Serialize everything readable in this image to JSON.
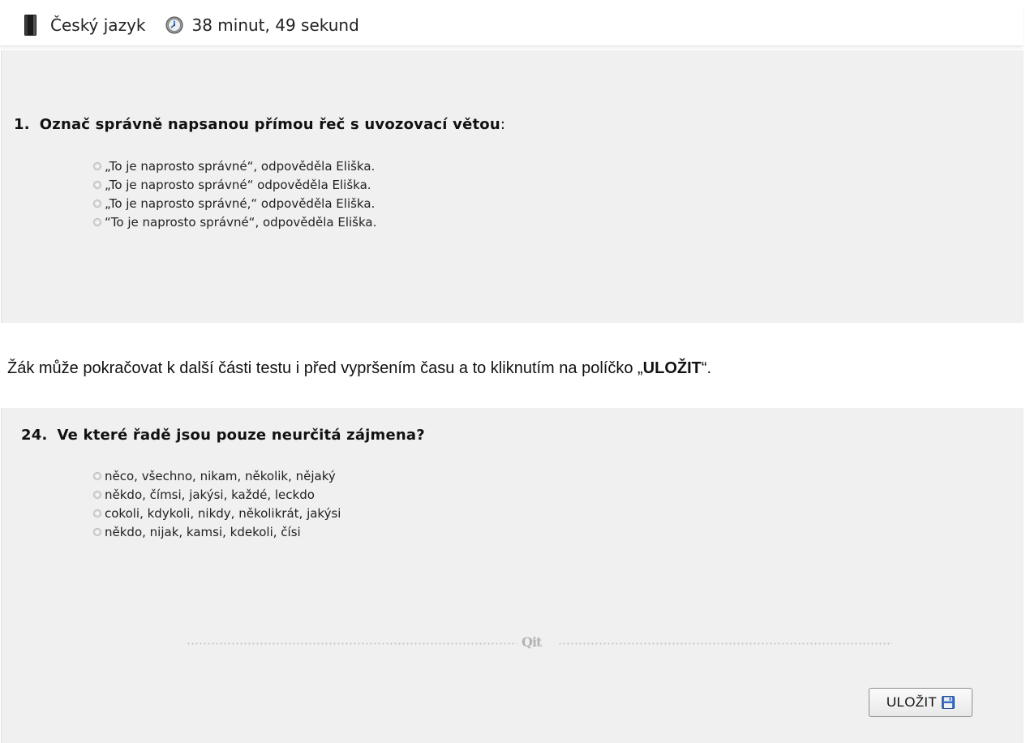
{
  "header": {
    "subject": "Český jazyk",
    "timer": "38 minut, 49 sekund",
    "icons": [
      "book-icon",
      "clock-icon"
    ]
  },
  "question1": {
    "number": "1.",
    "prefix": "Označ správně napsanou přímou řeč s uvozovací větou",
    "suffix": ":",
    "options": [
      "„To je naprosto správné“, odpověděla Eliška.",
      "„To je naprosto správné“ odpověděla Eliška.",
      "„To je naprosto správné,“ odpověděla Eliška.",
      "“To je naprosto správné“, odpověděla Eliška."
    ]
  },
  "note": {
    "before": "Žák může pokračovat k další části testu i před vypršením času a to kliknutím na políčko „",
    "bold": "ULOŽIT",
    "after": "“."
  },
  "question2": {
    "number": "24.",
    "text": "Ve které řadě jsou pouze neurčitá zájmena?",
    "options": [
      "něco, všechno, nikam, několik, nějaký",
      "někdo, čímsi, jakýsi, každé, leckdo",
      "cokoli, kdykoli, nikdy, několikrát, jakýsi",
      "někdo, nijak, kamsi, kdekoli, čísi"
    ]
  },
  "divider": {
    "logo": "Qit"
  },
  "save_button": {
    "label": "ULOŽIT",
    "icon": "floppy-disk-icon"
  },
  "colors": {
    "panel_bg": "#f0f0f0",
    "radio_border": "#b5b5b5",
    "divider_dots": "#c2c2c2"
  }
}
